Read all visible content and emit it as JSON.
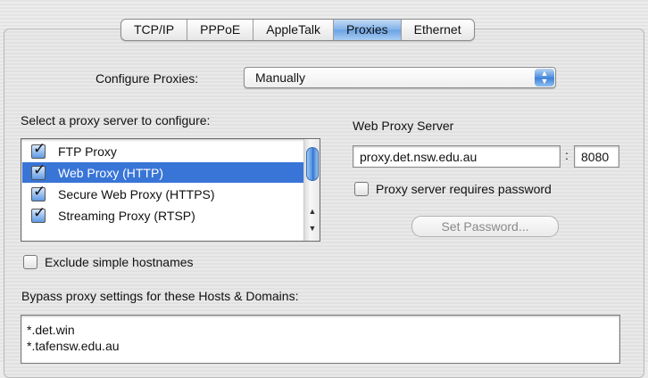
{
  "tabs": [
    {
      "label": "TCP/IP",
      "active": false
    },
    {
      "label": "PPPoE",
      "active": false
    },
    {
      "label": "AppleTalk",
      "active": false
    },
    {
      "label": "Proxies",
      "active": true
    },
    {
      "label": "Ethernet",
      "active": false
    }
  ],
  "configure": {
    "label": "Configure Proxies:",
    "value": "Manually"
  },
  "proxy_list": {
    "label": "Select a proxy server to configure:",
    "items": [
      {
        "label": "FTP Proxy",
        "checked": true,
        "selected": false
      },
      {
        "label": "Web Proxy (HTTP)",
        "checked": true,
        "selected": true
      },
      {
        "label": "Secure Web Proxy (HTTPS)",
        "checked": true,
        "selected": false
      },
      {
        "label": "Streaming Proxy (RTSP)",
        "checked": true,
        "selected": false
      }
    ]
  },
  "web_proxy": {
    "label": "Web Proxy Server",
    "host": "proxy.det.nsw.edu.au",
    "port": "8080",
    "requires_password_label": "Proxy server requires password",
    "set_password_label": "Set Password..."
  },
  "exclude_simple_label": "Exclude simple hostnames",
  "bypass": {
    "label": "Bypass proxy settings for these Hosts & Domains:",
    "value": "*.det.win\n*.tafensw.edu.au"
  },
  "colors": {
    "accent": "#3875d7",
    "active_tab": "#7fb0e8"
  }
}
